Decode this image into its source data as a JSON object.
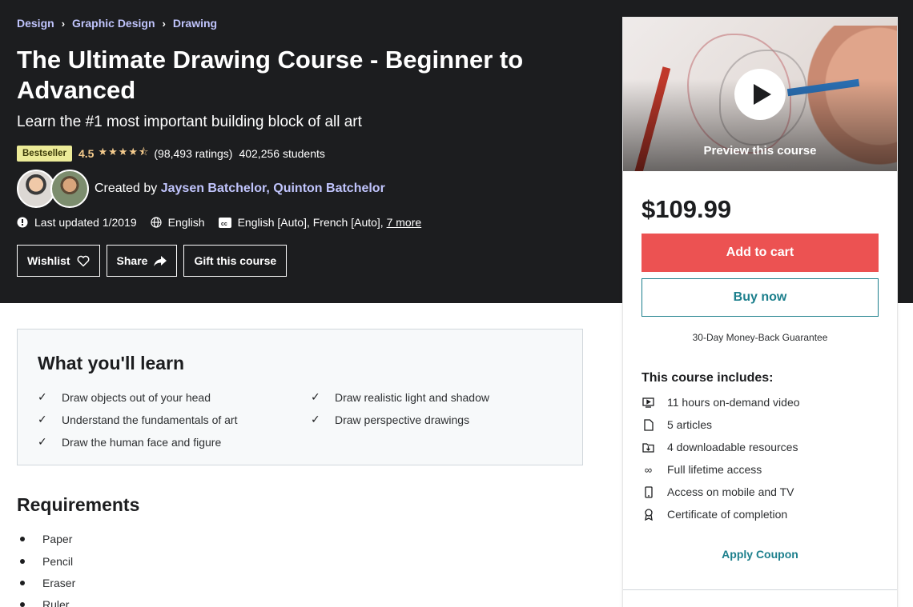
{
  "breadcrumb": [
    "Design",
    "Graphic Design",
    "Drawing"
  ],
  "course": {
    "title": "The Ultimate Drawing Course - Beginner to Advanced",
    "subtitle": "Learn the #1 most important building block of all art",
    "badge": "Bestseller",
    "rating": "4.5",
    "stars": "★★★★⯪",
    "ratings_count": "(98,493 ratings)",
    "students": "402,256 students",
    "created_by_label": "Created by",
    "instructor_1": "Jaysen Batchelor",
    "instructor_sep": ",",
    "instructor_2": "Quinton Batchelor",
    "last_updated": "Last updated 1/2019",
    "language": "English",
    "captions": "English [Auto], French [Auto],",
    "captions_more": "7 more"
  },
  "actions": {
    "wishlist": "Wishlist",
    "share": "Share",
    "gift": "Gift this course"
  },
  "learn": {
    "title": "What you'll learn",
    "items": [
      "Draw objects out of your head",
      "Understand the fundamentals of art",
      "Draw the human face and figure",
      "Draw realistic light and shadow",
      "Draw perspective drawings"
    ]
  },
  "requirements": {
    "title": "Requirements",
    "items": [
      "Paper",
      "Pencil",
      "Eraser",
      "Ruler"
    ]
  },
  "sidebar": {
    "preview_label": "Preview this course",
    "price": "$109.99",
    "add_to_cart": "Add to cart",
    "buy_now": "Buy now",
    "guarantee": "30-Day Money-Back Guarantee",
    "includes_title": "This course includes:",
    "includes": [
      {
        "icon": "video-icon",
        "text": "11 hours on-demand video"
      },
      {
        "icon": "file-icon",
        "text": "5 articles"
      },
      {
        "icon": "download-icon",
        "text": "4 downloadable resources"
      },
      {
        "icon": "infinity-icon",
        "text": "Full lifetime access"
      },
      {
        "icon": "mobile-icon",
        "text": "Access on mobile and TV"
      },
      {
        "icon": "certificate-icon",
        "text": "Certificate of completion"
      }
    ],
    "apply_coupon": "Apply Coupon"
  },
  "colors": {
    "hero_bg": "#1c1d1f",
    "link_purple": "#c0c4fc",
    "rating_gold": "#f3ca8c",
    "cart_red": "#ec5252",
    "teal": "#1c7f8c",
    "badge_yellow": "#eceb98"
  }
}
